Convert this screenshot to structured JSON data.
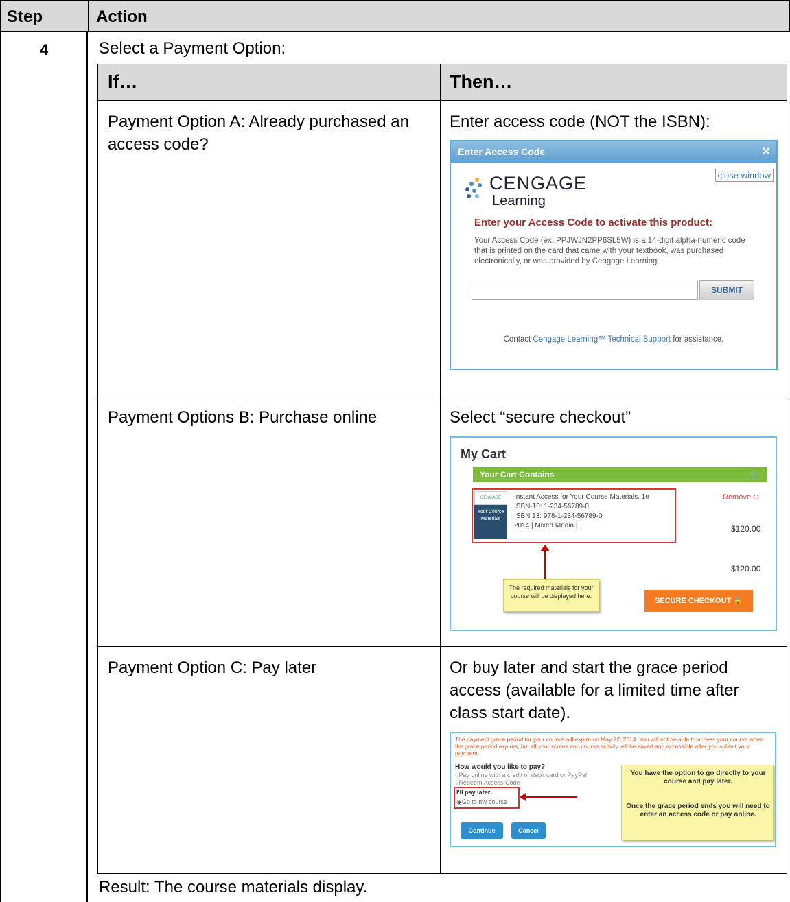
{
  "header": {
    "step_label": "Step",
    "action_label": "Action"
  },
  "step": {
    "number": "4",
    "instruction": "Select a Payment Option:"
  },
  "options_table": {
    "if_label": "If…",
    "then_label": "Then…",
    "rows": [
      {
        "if": "Payment Option A: Already purchased an access code?",
        "then": "Enter access code (NOT the ISBN):"
      },
      {
        "if": "Payment Options B: Purchase online",
        "then": "Select “secure checkout”"
      },
      {
        "if": "Payment Option C: Pay later",
        "then": "Or buy later and start the grace period access (available for a limited time after class start date)."
      }
    ]
  },
  "result": "Result: The course materials display.",
  "access_code_dialog": {
    "title": "Enter Access Code",
    "close_label": "close window",
    "brand_line1": "CENGAGE",
    "brand_line2": "Learning",
    "heading": "Enter your Access Code to activate this product:",
    "description": "Your Access Code (ex. PPJWJN2PP6SL5W) is a 14-digit alpha-numeric code that is printed on the card that came with your textbook, was purchased electronically, or was provided by Cengage Learning.",
    "submit_label": "SUBMIT",
    "contact_prefix": "Contact",
    "contact_link": "Cengage Learning™ Technical Support",
    "contact_suffix": "for assistance."
  },
  "cart": {
    "title": "My Cart",
    "bar_label": "Your Cart Contains",
    "thumb_brand": "CENGAGE Learning",
    "thumb_text": "Your Course Materials",
    "item_lines": [
      "Instant Access for Your Course Materials, 1e",
      "ISBN-10: 1-234-56789-0",
      "ISBN 13: 978-1-234-56789-0",
      "2014 | Mixed Media |"
    ],
    "remove_label": "Remove",
    "item_price": "$120.00",
    "total_price": "$120.00",
    "note": "The required materials for your course will be displayed here.",
    "checkout_label": "SECURE CHECKOUT"
  },
  "pay_later": {
    "warning": "The payment grace period for your course will expire on May 22, 2014. You will not be able to access your course when the grace period expires, but all your scores and course activity will be saved and accessible after you submit your payment.",
    "question": "How would you like to pay?",
    "option_online": "Pay online with a credit or debit card or PayPal",
    "option_redeem": "Redeem Access Code",
    "later_label": "I'll pay later",
    "option_goto": "Go to my course",
    "continue_label": "Continue",
    "cancel_label": "Cancel",
    "note_line1": "You have the option to go directly to your course and pay later.",
    "note_line2": "Once the grace period ends you will need to enter an access code or pay online."
  },
  "colors": {
    "header_bg": "#d9d9d9",
    "checkout": "#f47b20",
    "cart_bar": "#7dbb3c",
    "dialog_title": "#5f9fcf"
  }
}
